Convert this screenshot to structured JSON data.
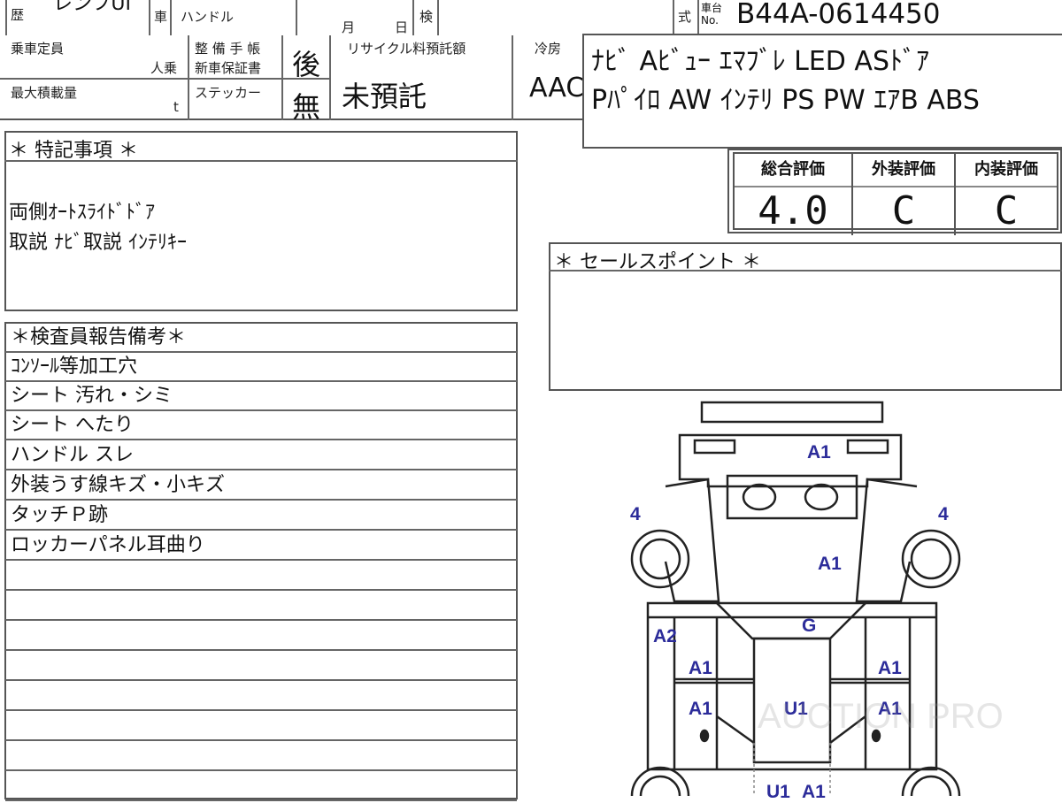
{
  "header": {
    "history_label": "歴",
    "model_fragment": "レンフUI",
    "car_label": "車",
    "handle_label": "ハンドル",
    "month_label": "月",
    "day_label": "日",
    "inspection_label": "検",
    "type_label": "式",
    "chassis_label_top": "車台",
    "chassis_label_no": "No.",
    "chassis_no": "B44A-0614450"
  },
  "specs": {
    "capacity_label": "乗車定員",
    "capacity_unit": "人乗",
    "maintenance_label": "整 備 手 帳",
    "warranty_label": "新車保証書",
    "warranty_value": "後",
    "max_load_label": "最大積載量",
    "max_load_unit": "t",
    "sticker_label": "ステッカー",
    "sticker_value": "無",
    "recycle_label": "リサイクル料預託額",
    "recycle_value": "未預託",
    "ac_label": "冷房",
    "ac_value": "AAC"
  },
  "equipment": {
    "line1": "ﾅﾋﾞ  Aﾋﾞｭｰ  ｴﾏﾌﾞﾚ  LED  ASﾄﾞｱ",
    "line2": "Pﾊﾟｲﾛ  AW  ｲﾝﾃﾘ  PS  PW  ｴｱB  ABS"
  },
  "scores": {
    "overall_label": "総合評価",
    "overall_value": "4.0",
    "exterior_label": "外装評価",
    "exterior_value": "C",
    "interior_label": "内装評価",
    "interior_value": "C"
  },
  "special_notes": {
    "title": "＊ 特記事項 ＊",
    "lines": [
      "両側ｵｰﾄｽﾗｲﾄﾞﾄﾞｱ",
      "取説  ﾅﾋﾞ取説  ｲﾝﾃﾘｷｰ"
    ]
  },
  "sales_point": {
    "title": "＊ セールスポイント ＊"
  },
  "inspector_report": {
    "title": "＊検査員報告備考＊",
    "lines": [
      "ｺﾝｿｰﾙ等加工穴",
      "シート 汚れ・シミ",
      "シート へたり",
      "ハンドル スレ",
      "外装うす線キズ・小キズ",
      "タッチＰ跡",
      "ロッカーパネル耳曲り"
    ]
  },
  "damage_marks": {
    "front_bumper": "A1",
    "left_front_tire": "4",
    "right_front_tire": "4",
    "hood": "A1",
    "windshield": "G",
    "left_front_fender": "A2",
    "left_front_door": "A1",
    "right_front_door": "A1",
    "left_rear_door": "A1",
    "roof": "U1",
    "right_rear_door": "A1",
    "rear_left": "U1",
    "rear_right": "A1"
  },
  "watermark": "AUCTION PRO",
  "colors": {
    "line": "#555555",
    "damage_mark": "#2c2c9a"
  }
}
